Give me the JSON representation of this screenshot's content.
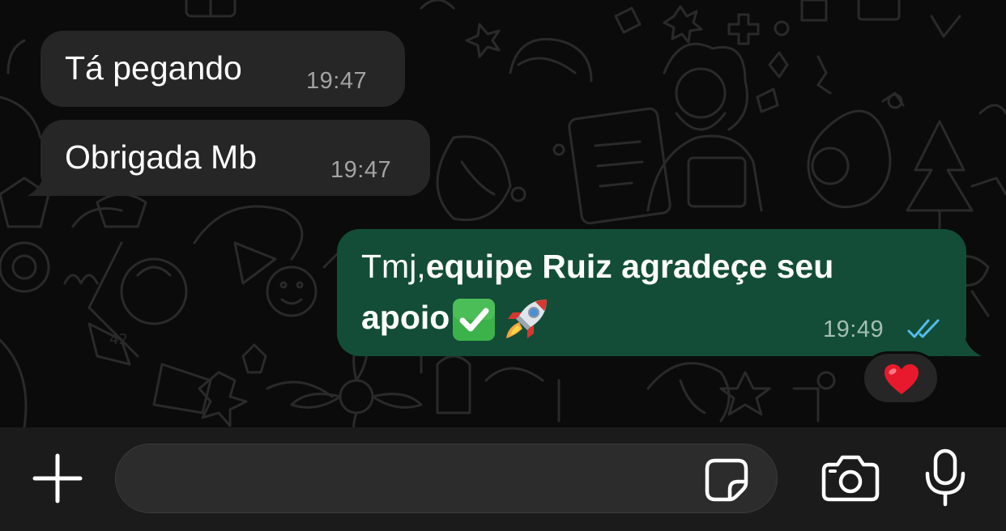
{
  "messages": [
    {
      "direction": "incoming",
      "text": "Tá pegando",
      "time": "19:47"
    },
    {
      "direction": "incoming",
      "text": "Obrigada Mb",
      "time": "19:47"
    },
    {
      "direction": "outgoing",
      "text_prefix": "Tmj,",
      "text_bold_line1": "equipe Ruiz agradeçe seu",
      "text_bold_line2": "apoio",
      "emojis": [
        "check-mark-button-emoji",
        "rocket-emoji"
      ],
      "time": "19:49",
      "status": "read",
      "reaction": "red-heart-emoji"
    }
  ],
  "composer": {
    "placeholder": "",
    "icons": [
      "plus-icon",
      "sticker-icon",
      "camera-icon",
      "microphone-icon"
    ]
  },
  "colors": {
    "background": "#0b0b0b",
    "incoming_bubble": "#262626",
    "outgoing_bubble": "#134d37",
    "read_ticks": "#53bdeb",
    "input_bar": "#1b1b1b"
  }
}
